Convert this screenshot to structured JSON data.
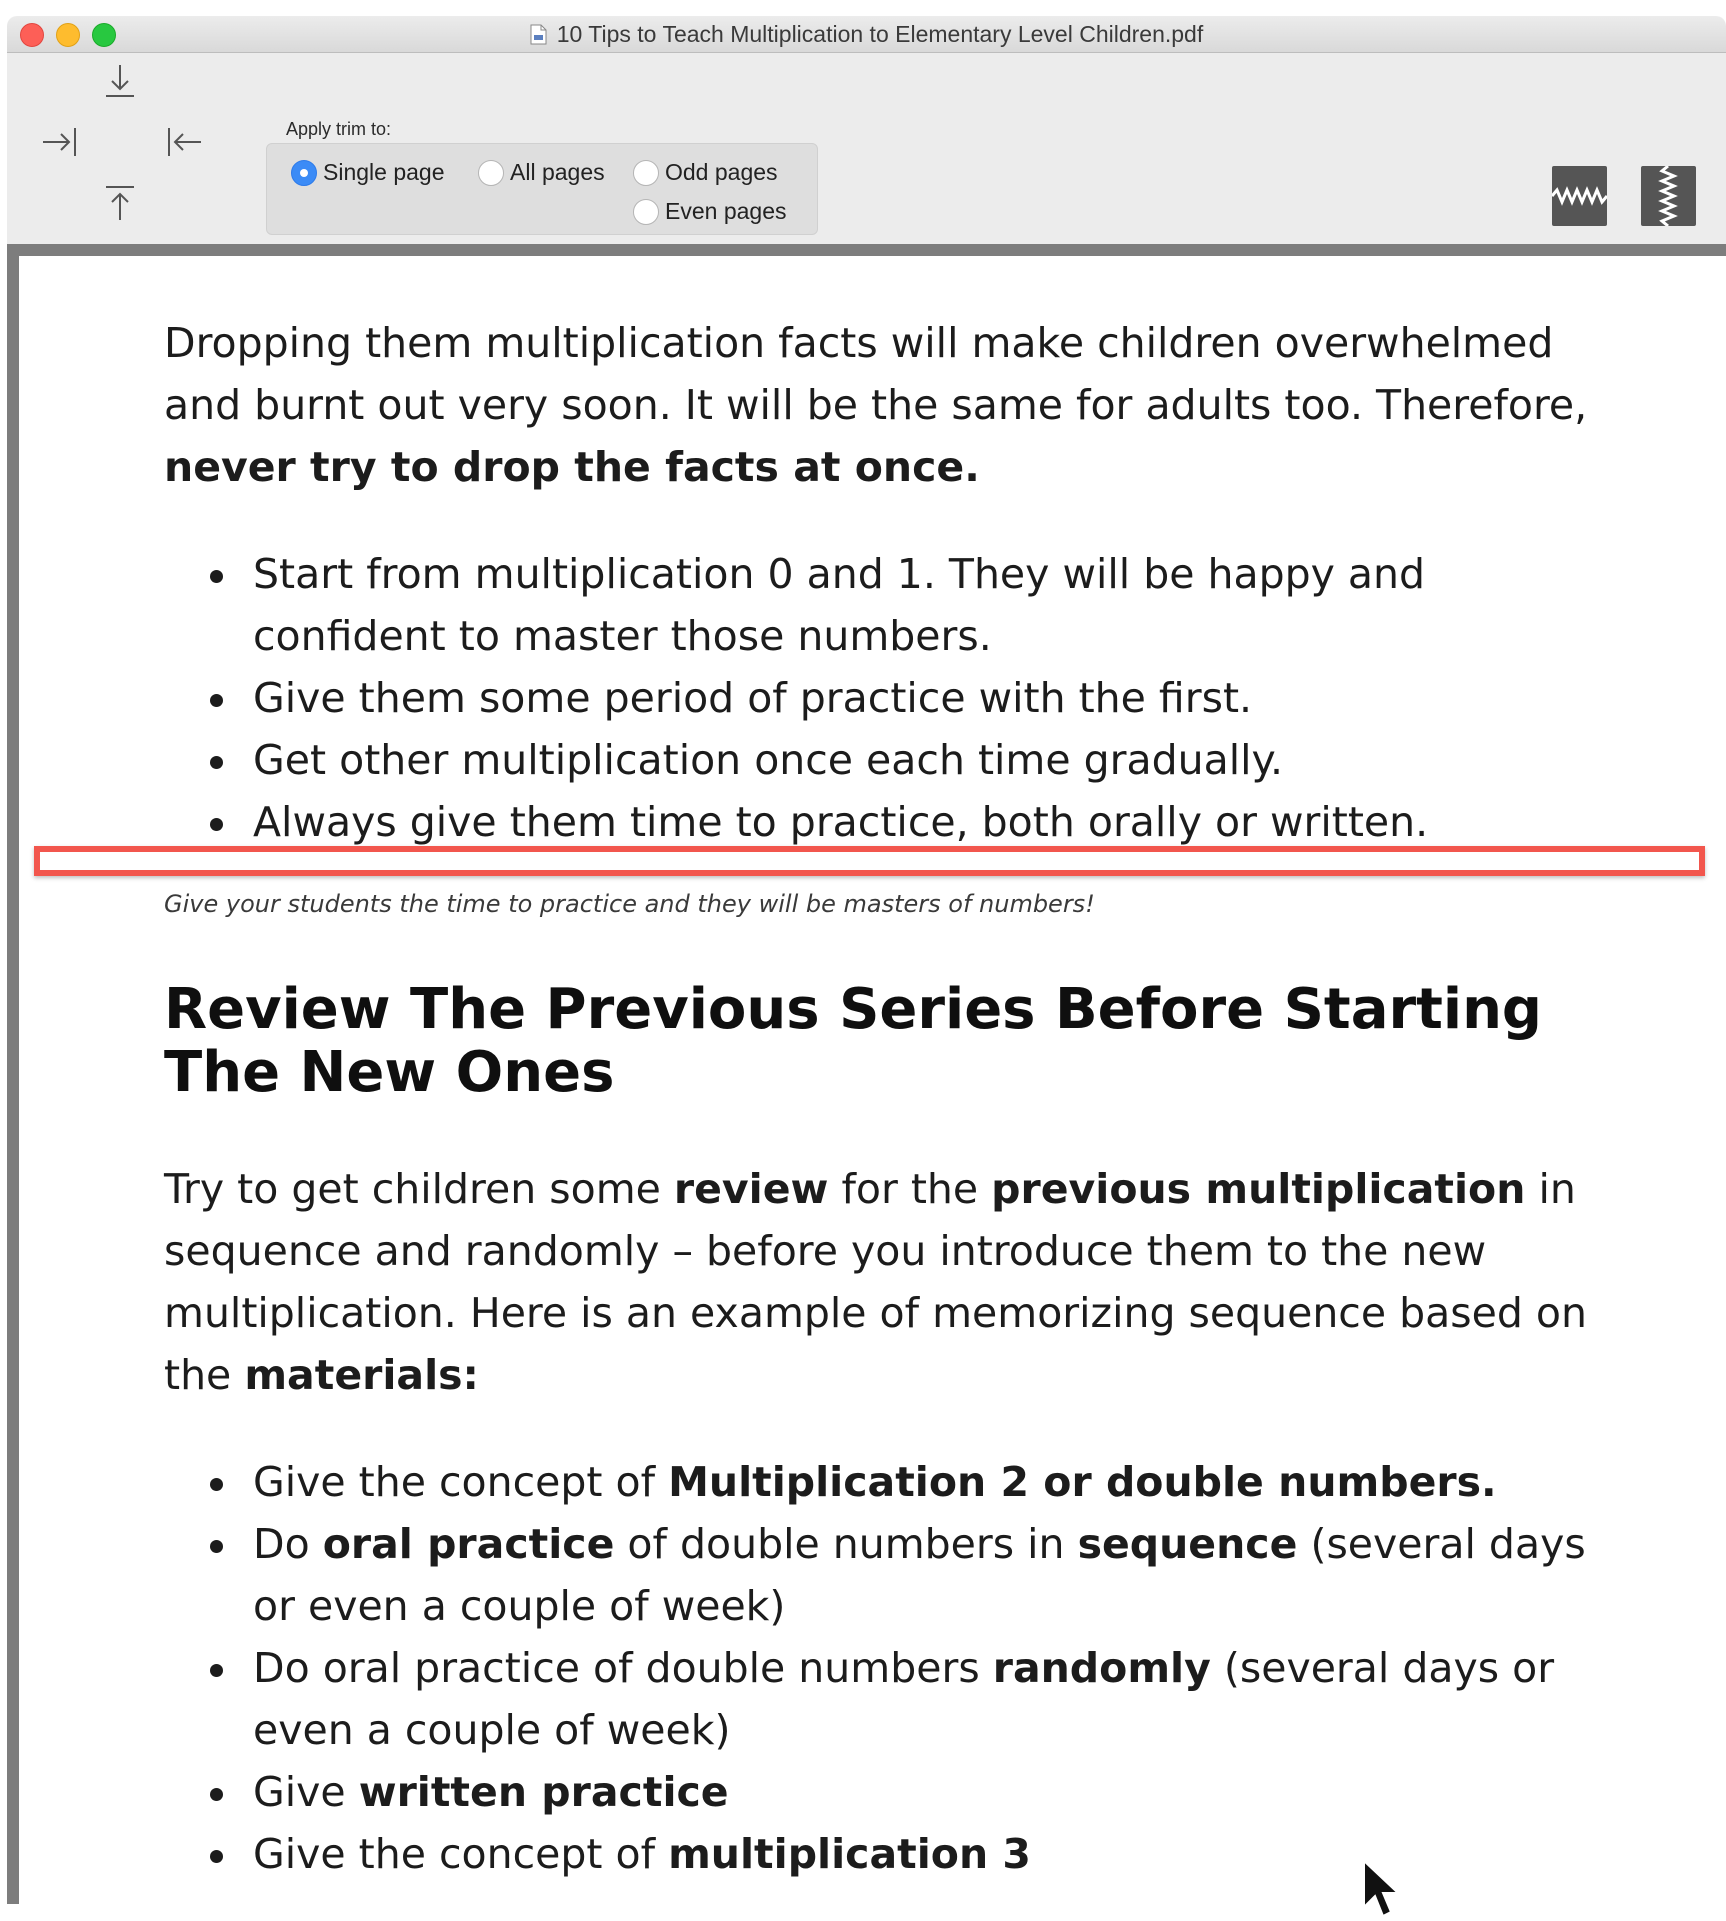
{
  "window": {
    "title": "10 Tips to Teach Multiplication to Elementary Level Children.pdf",
    "file_icon": "pdf-file-icon"
  },
  "toolbar": {
    "arrows": [
      "arrow-down-to-bar-icon",
      "arrow-right-to-bar-icon",
      "arrow-left-to-bar-icon",
      "arrow-up-from-bar-icon"
    ],
    "apply_trim_label": "Apply trim to:",
    "options": {
      "single_page": "Single page",
      "all_pages": "All pages",
      "odd_pages": "Odd pages",
      "even_pages": "Even pages"
    },
    "selected": "single_page",
    "split_v_label": "V",
    "split_h_label": "H"
  },
  "document": {
    "para1": {
      "text": "Dropping them multiplication facts will make children overwhelmed and burnt out very soon. It will be the same for adults too. Therefore, ",
      "bold": "never try to drop the facts at once."
    },
    "list1": [
      "Start from multiplication 0 and 1. They will be happy and confident to master those numbers.",
      "Give them some period of practice with the first.",
      "Get other multiplication once each time gradually.",
      "Always give them time to practice, both orally or written."
    ],
    "caption": "Give your students the time to practice and they will be masters of numbers!",
    "heading": "Review The Previous Series Before Starting The New Ones",
    "para2": {
      "t1": "Try to get children some ",
      "b1": "review",
      "t2": " for the ",
      "b2": "previous multiplication",
      "t3": " in sequence and randomly – before you introduce them to the new multiplication. Here is an example of memorizing sequence based on the ",
      "b3": "materials:"
    },
    "list2": {
      "i1": {
        "t1": "Give the concept of ",
        "b1": "Multiplication 2 or double numbers."
      },
      "i2": {
        "t1": "Do ",
        "b1": "oral practice",
        "t2": " of double numbers in ",
        "b2": "sequence",
        "t3": " (several days or even a couple of week)"
      },
      "i3": {
        "t1": "Do oral practice of double numbers ",
        "b1": "randomly",
        "t2": " (several days or even a couple of week)"
      },
      "i4": {
        "t1": "Give ",
        "b1": "written practice"
      },
      "i5": {
        "t1": "Give the concept of ",
        "b1": "multiplication 3"
      }
    },
    "trim_line_color": "#f2564d"
  }
}
